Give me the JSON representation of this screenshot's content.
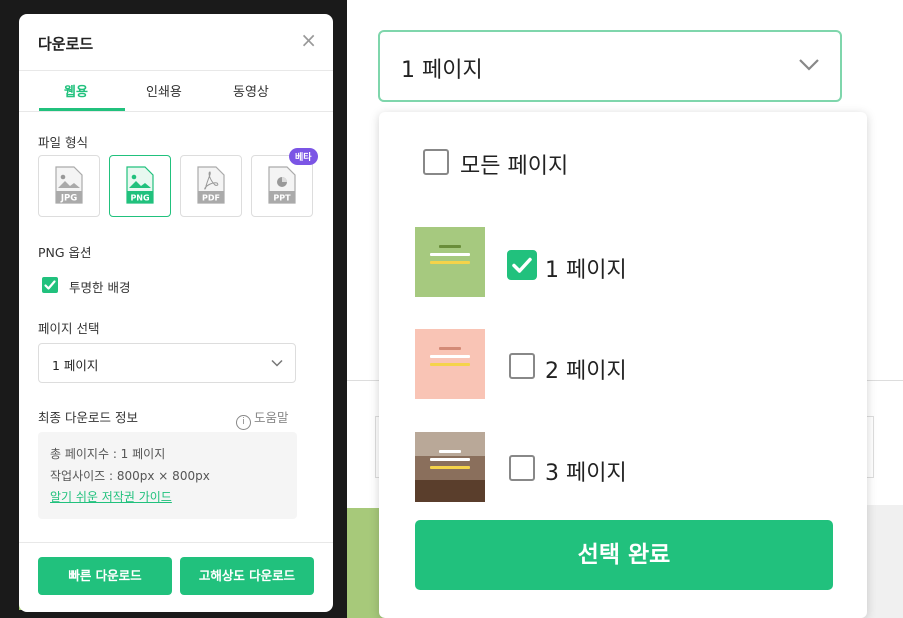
{
  "left_panel": {
    "title": "다운로드",
    "close": "×",
    "tabs": [
      "웹용",
      "인쇄용",
      "동영상"
    ],
    "file_format_label": "파일 형식",
    "formats": [
      "JPG",
      "PNG",
      "PDF",
      "PPT"
    ],
    "selected_format": "PNG",
    "beta_badge": "베타",
    "png_options_label": "PNG 옵션",
    "transparent_bg_label": "투명한 배경",
    "transparent_bg_checked": true,
    "page_select_label": "페이지 선택",
    "page_select_value": "1 페이지",
    "final_info_label": "최종 다운로드 정보",
    "help_label": "도움말",
    "info_total_pages": "총 페이지수 : 1 페이지",
    "info_size": "작업사이즈 : 800px × 800px",
    "info_guide_link": "알기 쉬운 저작권 가이드",
    "quick_download": "빠른 다운로드",
    "hq_download": "고해상도 다운로드"
  },
  "right_zoom": {
    "select_value": "1 페이지",
    "all_pages_label": "모든 페이지",
    "pages": [
      {
        "label": "1 페이지",
        "checked": true,
        "thumb_bg": "#a6c97f"
      },
      {
        "label": "2 페이지",
        "checked": false,
        "thumb_bg": "#f9c4b5"
      },
      {
        "label": "3 페이지",
        "checked": false,
        "thumb_bg": "#8a6f5c"
      }
    ],
    "confirm_button": "선택 완료"
  },
  "colors": {
    "accent": "#21c17d",
    "beta": "#7b55e5"
  }
}
